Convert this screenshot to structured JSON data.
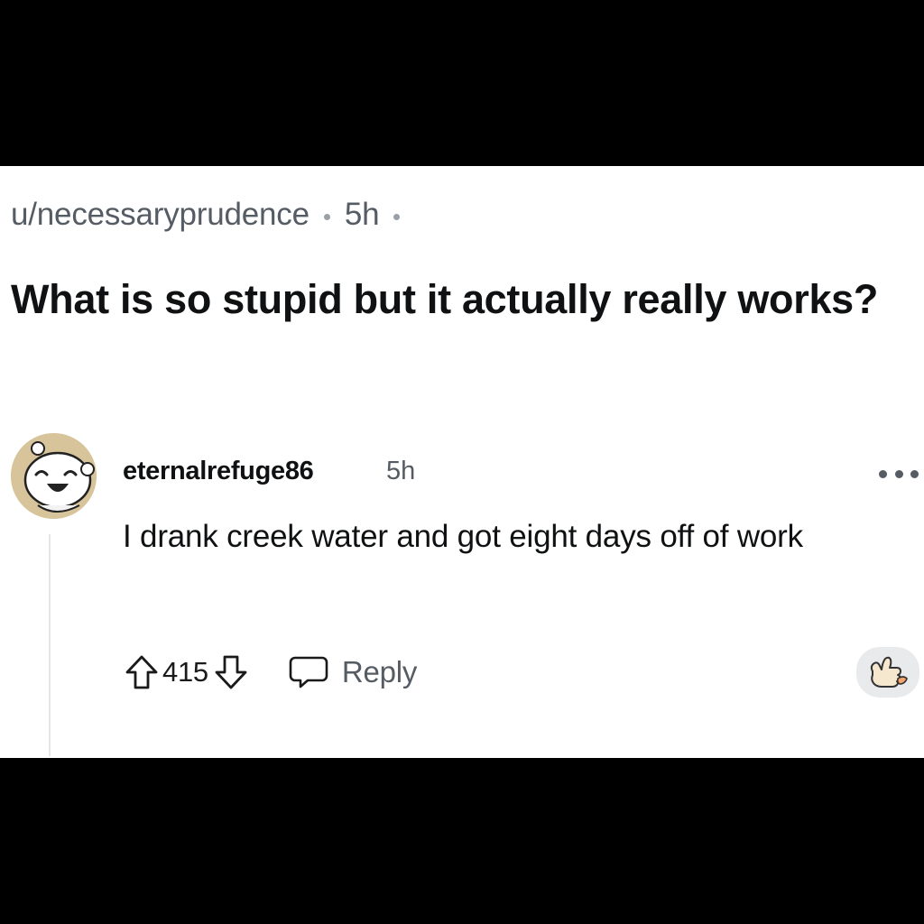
{
  "post": {
    "author": "u/necessaryprudence",
    "age": "5h",
    "title": "What is so stupid but it actually really works?"
  },
  "comment": {
    "author": "eternalrefuge86",
    "age": "5h",
    "body": "I drank creek water and got eight days off of work",
    "score": "415",
    "reply_label": "Reply",
    "avatar_icon": "snoo-avatar-icon",
    "more_icon": "more-options-icon",
    "award_icon": "award-thumbs-up-icon"
  },
  "colors": {
    "background": "#ffffff",
    "letterbox": "#000000",
    "text_primary": "#0f1112",
    "text_secondary": "#555c63",
    "avatar_bg": "#d8c49a",
    "award_bg": "#e9eaec"
  }
}
